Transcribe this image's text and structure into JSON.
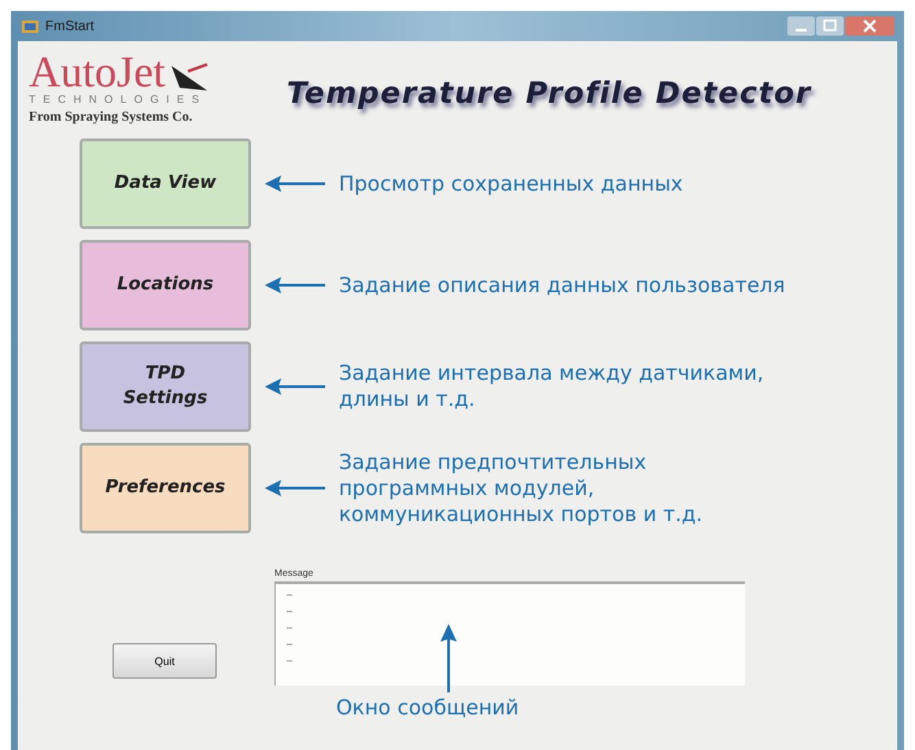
{
  "window": {
    "title": "FmStart"
  },
  "logo": {
    "name": "AutoJet",
    "tagline": "TECHNOLOGIES",
    "subtitle": "From Spraying Systems Co."
  },
  "app_title": "Temperature Profile Detector",
  "menu_buttons": [
    {
      "label": "Data View",
      "color": "#cfe6c4",
      "note": "Просмотр сохраненных данных"
    },
    {
      "label": "Locations",
      "color": "#e8bddb",
      "note": "Задание описания данных пользователя"
    },
    {
      "label": "TPD\nSettings",
      "color": "#c6c2e0",
      "note": "Задание интервала между датчиками,\nдлины и т.д."
    },
    {
      "label": "Preferences",
      "color": "#f8dcc0",
      "note": "Задание предпочтительных\nпрограммных модулей,\nкоммуникационных портов и т.д."
    }
  ],
  "quit_button": "Quit",
  "message_panel": {
    "label": "Message"
  },
  "message_note": "Окно сообщений"
}
